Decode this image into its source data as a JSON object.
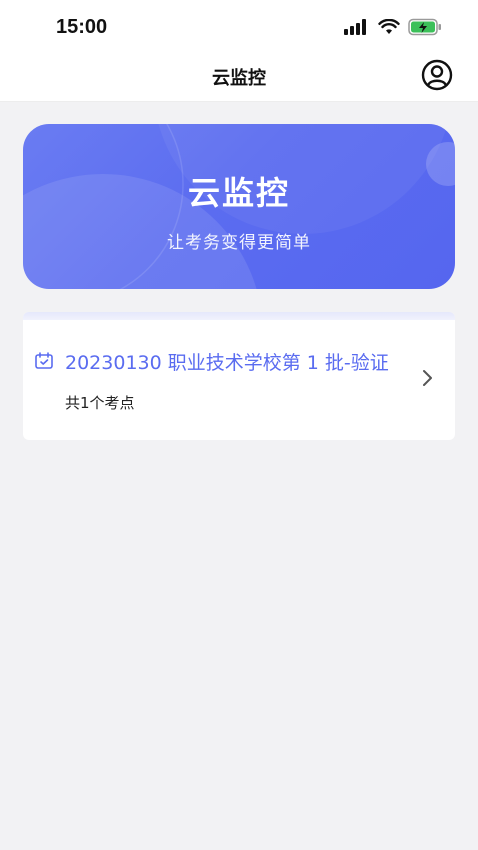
{
  "status_bar": {
    "time": "15:00"
  },
  "nav": {
    "title": "云监控",
    "profile_icon": "user-circle-icon"
  },
  "hero": {
    "title": "云监控",
    "subtitle": "让考务变得更简单",
    "colors": {
      "start": "#6a7cf2",
      "end": "#5566ef"
    }
  },
  "exam_list": [
    {
      "title": "20230130 职业技术学校第 1 批-验证",
      "subtitle": "共1个考点",
      "icon": "calendar-check-icon"
    }
  ],
  "colors": {
    "accent": "#5a6cf0",
    "background": "#f2f2f4"
  }
}
